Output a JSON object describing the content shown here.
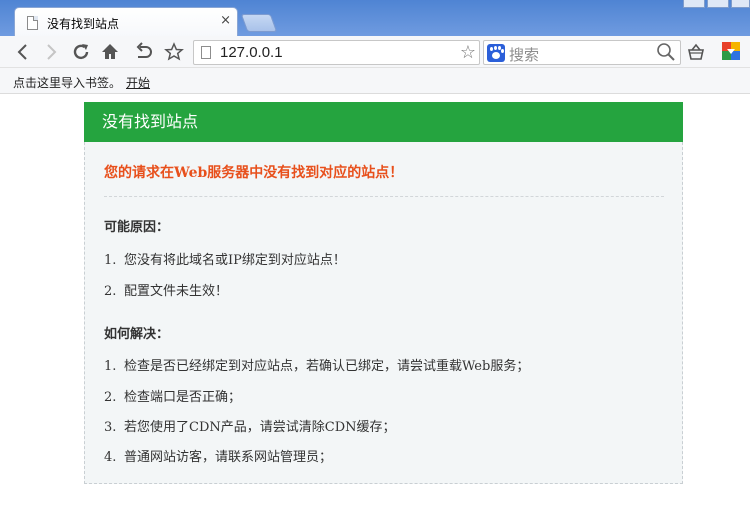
{
  "browser": {
    "tab": {
      "title": "没有找到站点",
      "close": "×"
    },
    "address": {
      "url": "127.0.0.1"
    },
    "search": {
      "placeholder": "搜索"
    },
    "bookmarks": {
      "hint": "点击这里导入书签。",
      "start": "开始"
    },
    "icons": [
      "back-icon",
      "forward-icon",
      "reload-icon",
      "home-icon",
      "undo-icon",
      "star-icon",
      "page-icon",
      "baidu-icon",
      "search-icon",
      "basket-icon",
      "google-badge-icon"
    ]
  },
  "page": {
    "header": "没有找到站点",
    "alert": "您的请求在Web服务器中没有找到对应的站点！",
    "reasons": {
      "title": "可能原因：",
      "items": [
        {
          "num": "1.",
          "text": "您没有将此域名或IP绑定到对应站点！"
        },
        {
          "num": "2.",
          "text": "配置文件未生效！"
        }
      ]
    },
    "solutions": {
      "title": "如何解决：",
      "items": [
        {
          "num": "1.",
          "text": "检查是否已经绑定到对应站点，若确认已绑定，请尝试重载Web服务；"
        },
        {
          "num": "2.",
          "text": "检查端口是否正确；"
        },
        {
          "num": "3.",
          "text": "若您使用了CDN产品，请尝试清除CDN缓存；"
        },
        {
          "num": "4.",
          "text": "普通网站访客，请联系网站管理员；"
        }
      ]
    }
  },
  "colors": {
    "header_green": "#25a43f",
    "alert_orange": "#e8501c",
    "body_bg": "#f3f6f7"
  }
}
